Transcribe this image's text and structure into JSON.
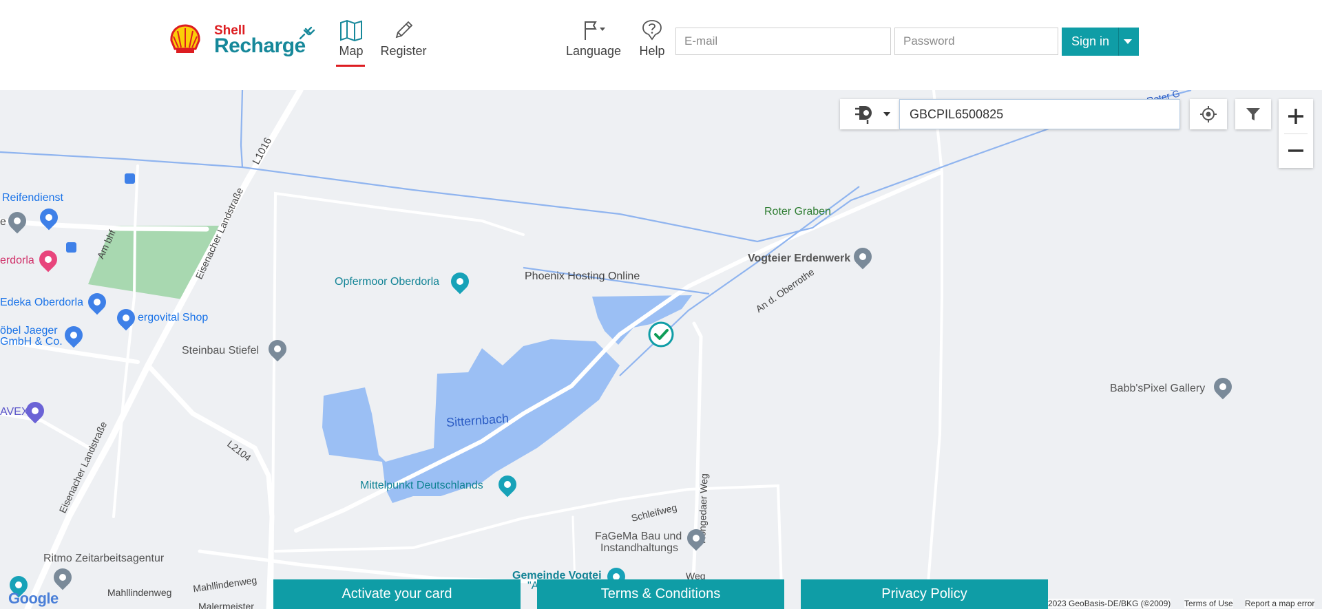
{
  "brand": {
    "shell": "Shell",
    "recharge": "Recharge"
  },
  "nav": {
    "map": "Map",
    "register": "Register",
    "language": "Language",
    "help": "Help"
  },
  "auth": {
    "email_placeholder": "E-mail",
    "password_placeholder": "Password",
    "signin_label": "Sign in"
  },
  "search": {
    "value": "GBCPIL6500825"
  },
  "map": {
    "roads": [
      "L1016",
      "Eisenacher Landstraße",
      "Eisenacher Landstraße",
      "L2104",
      "Am bhf",
      "An d. Oberrothe",
      "Höngedaer Weg",
      "Schleifweg",
      "Mahllindenweg",
      "Mahllindenweg",
      "Malermeister",
      "Weg"
    ],
    "water_labels": [
      "Sitternbach",
      "Roter Graben",
      "Roter G"
    ],
    "places": [
      "Reifendienst",
      "e",
      "erdorla",
      "Edeka Oberdorla",
      "ergovital Shop",
      "öbel Jaeger",
      "GmbH & Co.",
      "AVEX",
      "Steinbau Stiefel",
      "Opfermoor Oberdorla",
      "Phoenix Hosting Online",
      "Vogteier Erdenwerk",
      "Babb'sPixel Gallery",
      "Mittelpunkt Deutschlands",
      "FaGeMa Bau und",
      "Instandhaltungs",
      "Gemeinde Vogtei",
      "\"A",
      "Ritmo Zeitarbeitsagentur"
    ]
  },
  "attribution": {
    "google": "Google",
    "copyright": "2023 GeoBasis-DE/BKG (©2009)",
    "terms": "Terms of Use",
    "report": "Report a map error"
  },
  "footer": {
    "activate": "Activate your card",
    "terms": "Terms & Conditions",
    "privacy": "Privacy Policy"
  },
  "colors": {
    "accent": "#0f9da6",
    "brand_red": "#dd1d21",
    "brand_teal": "#16889a",
    "water": "#9bbff4",
    "park": "#a8d8b0"
  }
}
